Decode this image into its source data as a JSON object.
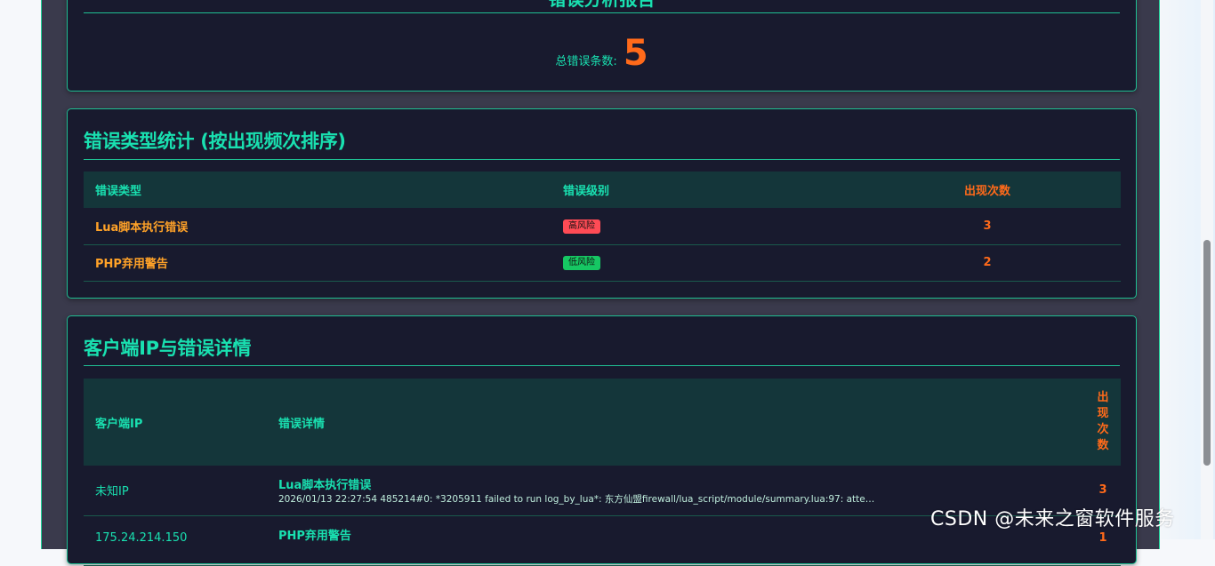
{
  "summary": {
    "cut_title": "错误分析报告",
    "total_label": "总错误条数:",
    "total_value": "5"
  },
  "type_stats": {
    "title": "错误类型统计 (按出现频次排序)",
    "columns": [
      "错误类型",
      "错误级别",
      "出现次数"
    ],
    "rows": [
      {
        "type": "Lua脚本执行错误",
        "level": "高风险",
        "level_color": "#ff4b55",
        "count": "3"
      },
      {
        "type": "PHP弃用警告",
        "level": "低风险",
        "level_color": "#16c763",
        "count": "2"
      }
    ]
  },
  "ip_details": {
    "title": "客户端IP与错误详情",
    "columns": {
      "ip": "客户端IP",
      "detail": "错误详情",
      "count_chars": [
        "出",
        "现",
        "次",
        "数"
      ]
    },
    "rows": [
      {
        "ip": "未知IP",
        "error_title": "Lua脚本执行错误",
        "error_message": "2026/01/13 22:27:54 485214#0: *3205911 failed to run log_by_lua*: 东方仙盟firewall/lua_script/module/summary.lua:97: attemp...",
        "count": "3"
      },
      {
        "ip": "175.24.214.150",
        "error_title": "PHP弃用警告",
        "error_message": "",
        "count": "1"
      }
    ]
  },
  "watermark": "CSDN @未来之窗软件服务",
  "colors": {
    "accent": "#19e0b0",
    "count": "#ff6a1a",
    "type": "#ffa228",
    "panel": "#181a2e"
  }
}
